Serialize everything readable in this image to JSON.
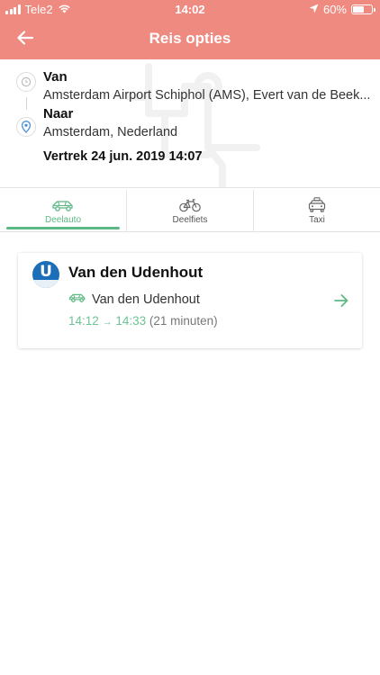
{
  "status_bar": {
    "carrier": "Tele2",
    "time": "14:02",
    "battery_percent_label": "60%",
    "battery_level": 0.6
  },
  "header": {
    "title": "Reis opties",
    "back_icon": "arrow-left-icon",
    "background_color": "#ee8a80"
  },
  "route": {
    "from_label": "Van",
    "from_value": "Amsterdam Airport Schiphol (AMS), Evert van de Beek...",
    "to_label": "Naar",
    "to_value": "Amsterdam, Nederland",
    "departure": "Vertrek 24 jun. 2019 14:07"
  },
  "tabs": [
    {
      "label": "Deelauto",
      "icon": "car-icon",
      "active": true
    },
    {
      "label": "Deelfiets",
      "icon": "bicycle-icon",
      "active": false
    },
    {
      "label": "Taxi",
      "icon": "taxi-icon",
      "active": false
    }
  ],
  "results": [
    {
      "logo_letter": "U",
      "title": "Van den Udenhout",
      "provider": "Van den Udenhout",
      "depart_time": "14:12",
      "time_separator": "→",
      "arrive_time": "14:33",
      "duration": "(21 minuten)"
    }
  ],
  "colors": {
    "accent": "#ee8a80",
    "green": "#5cb985"
  }
}
